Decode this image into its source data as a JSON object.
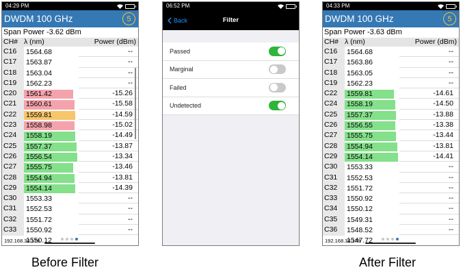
{
  "left": {
    "time": "04:29 PM",
    "app_title": "DWDM 100 GHz",
    "badge": "5",
    "span_power": "Span Power -3.62 dBm",
    "headers": [
      "CH#",
      "λ (nm)",
      "Power (dBm)"
    ],
    "rows": [
      {
        "ch": "C16",
        "wl": "1564.68",
        "pw": "--",
        "status": "none"
      },
      {
        "ch": "C17",
        "wl": "1563.87",
        "pw": "--",
        "status": "none"
      },
      {
        "ch": "C18",
        "wl": "1563.04",
        "pw": "--",
        "status": "none"
      },
      {
        "ch": "C19",
        "wl": "1562.23",
        "pw": "--",
        "status": "none"
      },
      {
        "ch": "C20",
        "wl": "1561.42",
        "pw": "-15.26",
        "status": "failed"
      },
      {
        "ch": "C21",
        "wl": "1560.61",
        "pw": "-15.58",
        "status": "failed"
      },
      {
        "ch": "C22",
        "wl": "1559.81",
        "pw": "-14.59",
        "status": "marginal"
      },
      {
        "ch": "C23",
        "wl": "1558.98",
        "pw": "-15.02",
        "status": "failed"
      },
      {
        "ch": "C24",
        "wl": "1558.19",
        "pw": "-14.49",
        "status": "passed"
      },
      {
        "ch": "C25",
        "wl": "1557.37",
        "pw": "-13.87",
        "status": "passed"
      },
      {
        "ch": "C26",
        "wl": "1556.54",
        "pw": "-13.34",
        "status": "passed"
      },
      {
        "ch": "C27",
        "wl": "1555.75",
        "pw": "-13.46",
        "status": "passed"
      },
      {
        "ch": "C28",
        "wl": "1554.94",
        "pw": "-13.81",
        "status": "passed"
      },
      {
        "ch": "C29",
        "wl": "1554.14",
        "pw": "-14.39",
        "status": "passed"
      },
      {
        "ch": "C30",
        "wl": "1553.33",
        "pw": "--",
        "status": "none"
      },
      {
        "ch": "C31",
        "wl": "1552.53",
        "pw": "--",
        "status": "none"
      },
      {
        "ch": "C32",
        "wl": "1551.72",
        "pw": "--",
        "status": "none"
      },
      {
        "ch": "C33",
        "wl": "1550.92",
        "pw": "--",
        "status": "none"
      },
      {
        "ch": "C34",
        "wl": "1550.12",
        "pw": "--",
        "status": "none"
      }
    ],
    "ip": "192.168.34.178"
  },
  "filter": {
    "time": "06:52 PM",
    "back_label": "Back",
    "title": "Filter",
    "options": [
      {
        "label": "Passed",
        "on": true
      },
      {
        "label": "Marginal",
        "on": false
      },
      {
        "label": "Failed",
        "on": false
      },
      {
        "label": "Undetected",
        "on": true
      }
    ]
  },
  "right": {
    "time": "04:33 PM",
    "app_title": "DWDM 100 GHz",
    "badge": "5",
    "span_power": "Span Power -3.63 dBm",
    "headers": [
      "CH#",
      "λ (nm)",
      "Power (dBm)"
    ],
    "rows": [
      {
        "ch": "C16",
        "wl": "1564.68",
        "pw": "--",
        "status": "none"
      },
      {
        "ch": "C17",
        "wl": "1563.86",
        "pw": "--",
        "status": "none"
      },
      {
        "ch": "C18",
        "wl": "1563.05",
        "pw": "--",
        "status": "none"
      },
      {
        "ch": "C19",
        "wl": "1562.23",
        "pw": "--",
        "status": "none"
      },
      {
        "ch": "C22",
        "wl": "1559.81",
        "pw": "-14.61",
        "status": "passed"
      },
      {
        "ch": "C24",
        "wl": "1558.19",
        "pw": "-14.50",
        "status": "passed"
      },
      {
        "ch": "C25",
        "wl": "1557.37",
        "pw": "-13.88",
        "status": "passed"
      },
      {
        "ch": "C26",
        "wl": "1556.55",
        "pw": "-13.38",
        "status": "passed"
      },
      {
        "ch": "C27",
        "wl": "1555.75",
        "pw": "-13.44",
        "status": "passed"
      },
      {
        "ch": "C28",
        "wl": "1554.94",
        "pw": "-13.81",
        "status": "passed"
      },
      {
        "ch": "C29",
        "wl": "1554.14",
        "pw": "-14.41",
        "status": "passed"
      },
      {
        "ch": "C30",
        "wl": "1553.33",
        "pw": "--",
        "status": "none"
      },
      {
        "ch": "C31",
        "wl": "1552.53",
        "pw": "--",
        "status": "none"
      },
      {
        "ch": "C32",
        "wl": "1551.72",
        "pw": "--",
        "status": "none"
      },
      {
        "ch": "C33",
        "wl": "1550.92",
        "pw": "--",
        "status": "none"
      },
      {
        "ch": "C34",
        "wl": "1550.12",
        "pw": "--",
        "status": "none"
      },
      {
        "ch": "C35",
        "wl": "1549.31",
        "pw": "--",
        "status": "none"
      },
      {
        "ch": "C36",
        "wl": "1548.52",
        "pw": "--",
        "status": "none"
      },
      {
        "ch": "C37",
        "wl": "1547.72",
        "pw": "--",
        "status": "none"
      }
    ],
    "ip": "192.168.34.178"
  },
  "captions": {
    "before": "Before Filter",
    "after": "After Filter"
  },
  "colors": {
    "header_blue": "#3478b4",
    "passed": "#84e08a",
    "marginal": "#f7c66a",
    "failed": "#f4a3ad",
    "toggle_on": "#2eb53a",
    "toggle_off": "#c9c9c9",
    "back_blue": "#1e90ff"
  },
  "icons": [
    "wifi-icon",
    "battery-icon",
    "chevron-left-icon"
  ]
}
